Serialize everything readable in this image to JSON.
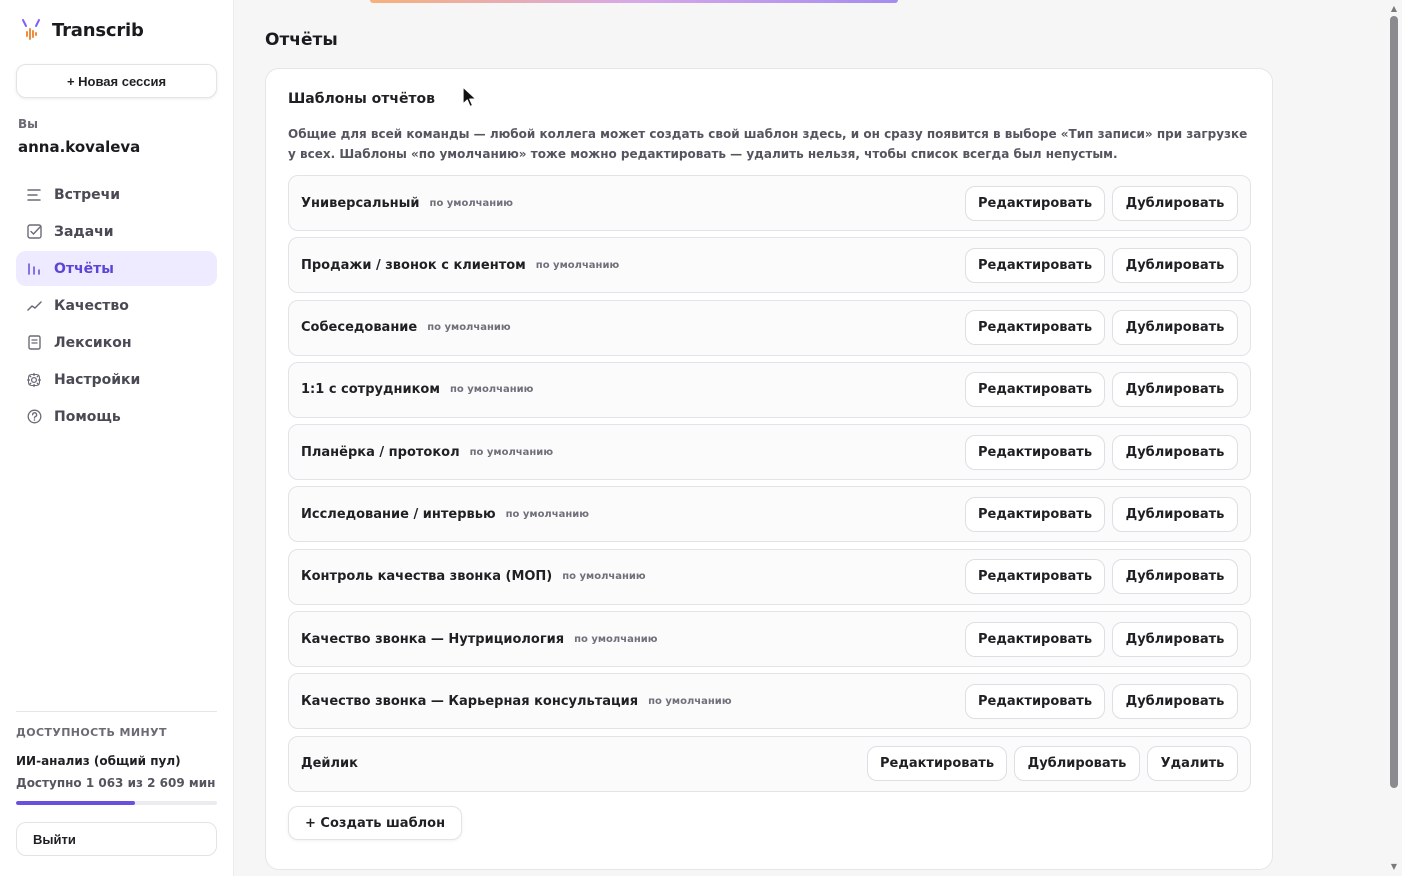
{
  "app": {
    "brand": "Transcrib",
    "accent_color": "#6b4fe0"
  },
  "sidebar": {
    "new_session_label": "+ Новая сессия",
    "you_label": "Вы",
    "username": "anna.kovaleva",
    "nav": [
      {
        "label": "Встречи",
        "icon": "lines-icon"
      },
      {
        "label": "Задачи",
        "icon": "checkbox-icon"
      },
      {
        "label": "Отчёты",
        "icon": "bars-icon",
        "active": true
      },
      {
        "label": "Качество",
        "icon": "trend-icon"
      },
      {
        "label": "Лексикон",
        "icon": "book-icon"
      },
      {
        "label": "Настройки",
        "icon": "gear-icon"
      },
      {
        "label": "Помощь",
        "icon": "help-icon"
      }
    ],
    "minutes": {
      "title": "Доступность минут",
      "pool_label": "ИИ-анализ (общий пул)",
      "available_text": "Доступно 1 063 из 2 609 мин",
      "used_fraction": 0.593
    },
    "logout_label": "Выйти"
  },
  "main": {
    "page_title": "Отчёты",
    "card": {
      "title": "Шаблоны отчётов",
      "description": "Общие для всей команды — любой коллега может создать свой шаблон здесь, и он сразу появится в выборе «Тип записи» при загрузке у всех. Шаблоны «по умолчанию» тоже можно редактировать — удалить нельзя, чтобы список всегда был непустым.",
      "edit_label": "Редактировать",
      "duplicate_label": "Дублировать",
      "delete_label": "Удалить",
      "default_badge": "по умолчанию",
      "templates": [
        {
          "name": "Универсальный",
          "is_default": true
        },
        {
          "name": "Продажи / звонок с клиентом",
          "is_default": true
        },
        {
          "name": "Собеседование",
          "is_default": true
        },
        {
          "name": "1:1 с сотрудником",
          "is_default": true
        },
        {
          "name": "Планёрка / протокол",
          "is_default": true
        },
        {
          "name": "Исследование / интервью",
          "is_default": true
        },
        {
          "name": "Контроль качества звонка (МОП)",
          "is_default": true
        },
        {
          "name": "Качество звонка — Нутрициология",
          "is_default": true
        },
        {
          "name": "Качество звонка — Карьерная консультация",
          "is_default": true
        },
        {
          "name": "Дейлик",
          "is_default": false
        }
      ],
      "create_label": "+ Создать шаблон"
    }
  }
}
